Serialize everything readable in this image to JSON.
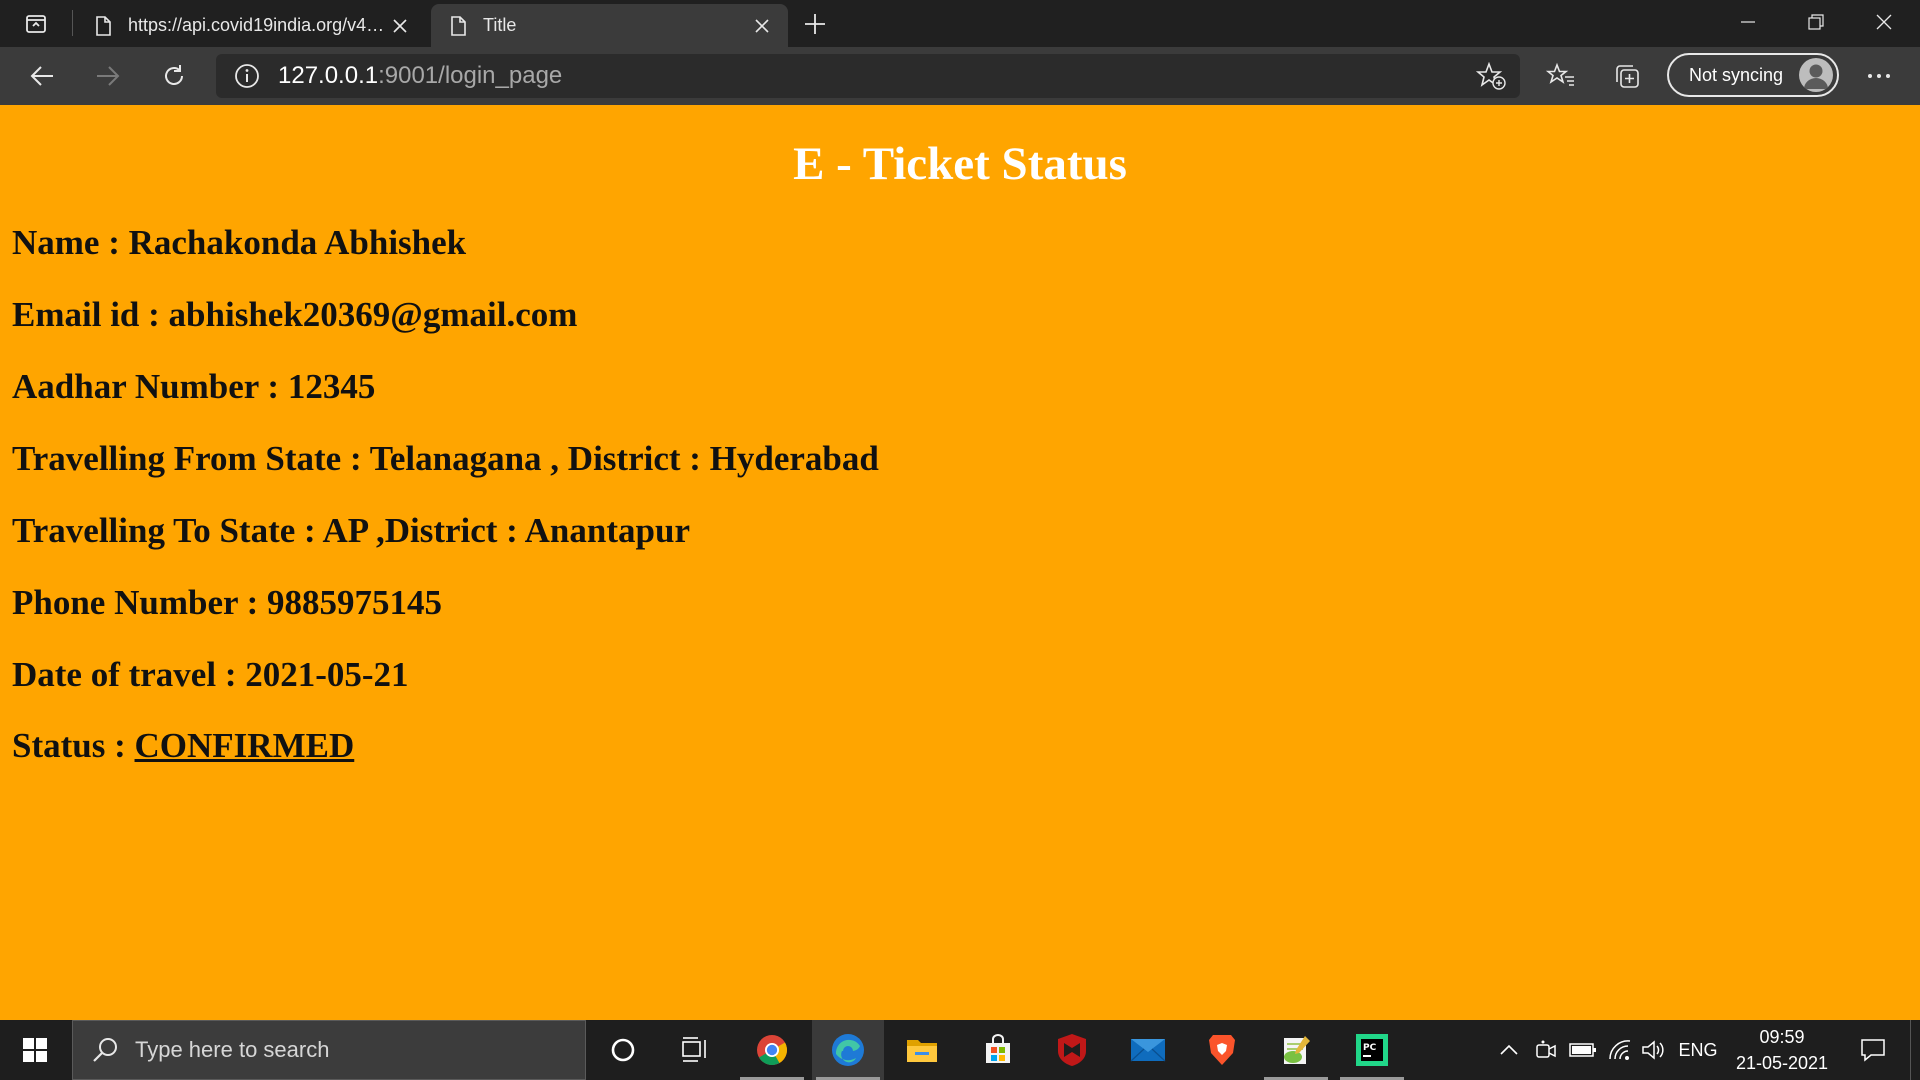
{
  "browser": {
    "tabs": [
      {
        "label": "https://api.covid19india.org/v4/data.json"
      },
      {
        "label": "Title"
      }
    ],
    "address": {
      "host": "127.0.0.1",
      "rest": ":9001/login_page"
    },
    "sync_label": "Not syncing"
  },
  "page": {
    "heading": "E - Ticket Status",
    "name": "Name : Rachakonda Abhishek",
    "email": "Email id : abhishek20369@gmail.com",
    "aadhar": "Aadhar Number : 12345",
    "from": "Travelling From State : Telanagana , District : Hyderabad",
    "to": "Travelling To State : AP ,District : Anantapur",
    "phone": "Phone Number : 9885975145",
    "date": "Date of travel : 2021-05-21",
    "status_label": "Status : ",
    "status_value": "CONFIRMED",
    "background_color": "#ffa500"
  },
  "taskbar": {
    "search_placeholder": "Type here to search",
    "language": "ENG",
    "time": "09:59",
    "date": "21-05-2021"
  }
}
